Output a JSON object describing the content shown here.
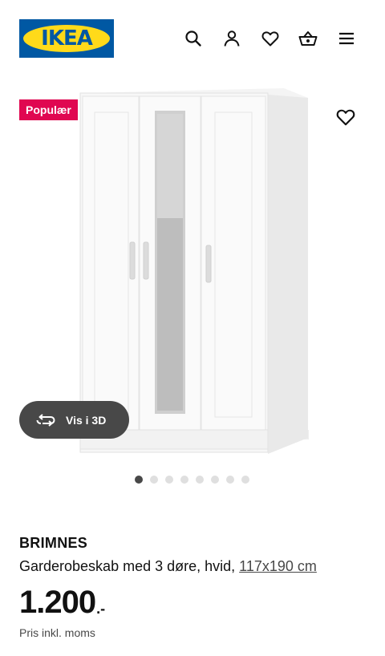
{
  "header": {
    "logo_text": "IKEA",
    "icons": [
      "search-icon",
      "user-icon",
      "heart-icon",
      "basket-icon",
      "menu-icon"
    ]
  },
  "product_image": {
    "badge": "Populær",
    "view_3d_label": "Vis i 3D",
    "carousel": {
      "total": 8,
      "active_index": 0
    }
  },
  "product": {
    "name": "BRIMNES",
    "description": "Garderobeskab med 3 døre, hvid,",
    "measurement": "117x190 cm",
    "price_integer": "1.200",
    "price_decimal": ".-",
    "price_note": "Pris inkl. moms"
  },
  "colors": {
    "ikea_blue": "#0058a3",
    "ikea_yellow": "#ffda1a",
    "badge_red": "#e00751",
    "dark_button": "#484848"
  }
}
